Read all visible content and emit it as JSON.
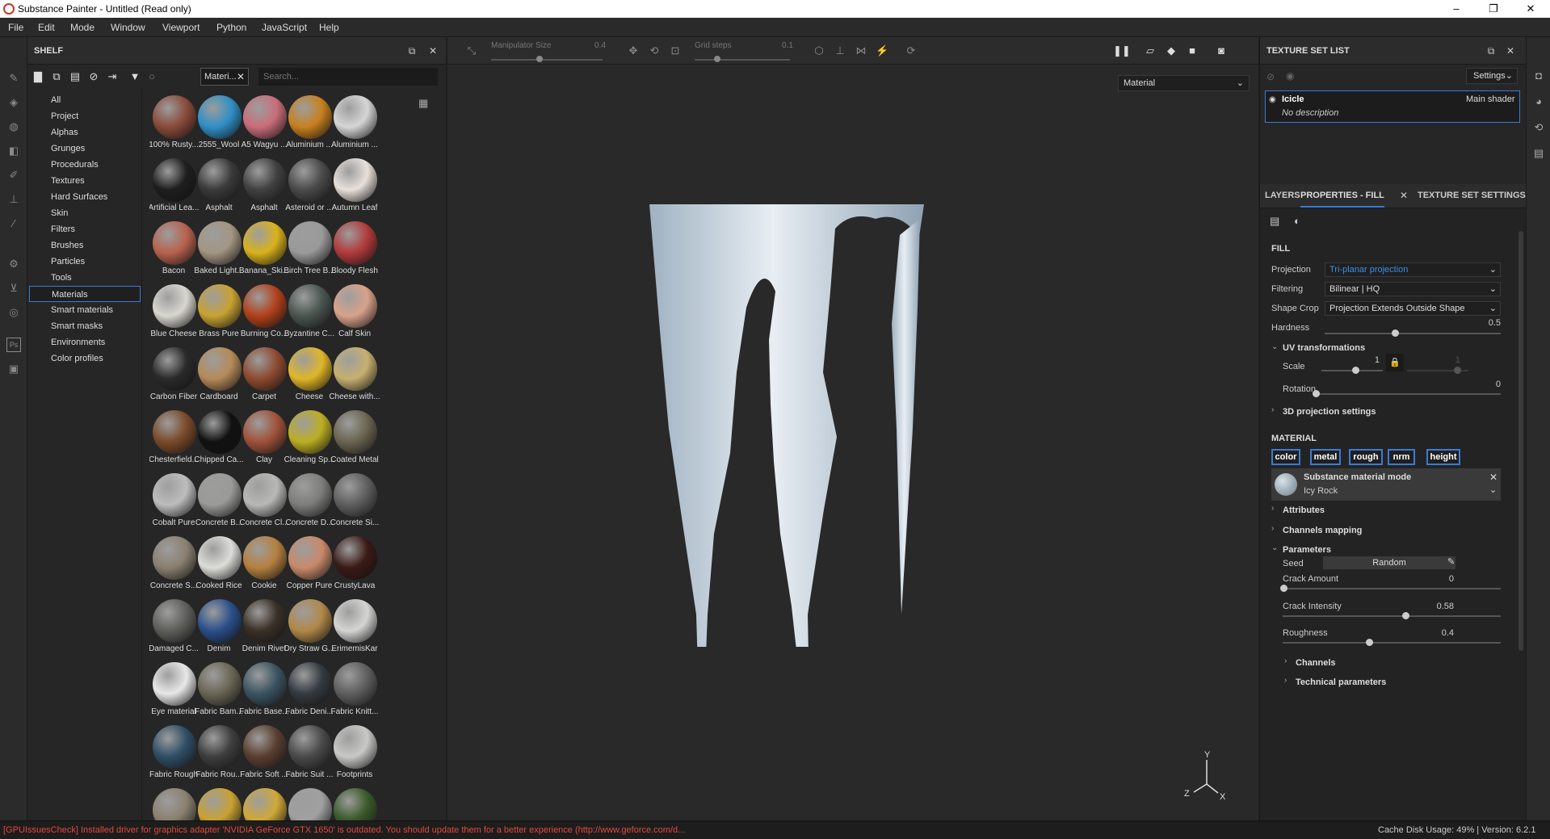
{
  "window": {
    "title": "Substance Painter - Untitled (Read only)",
    "minimize": "–",
    "maximize": "❐",
    "close": "✕"
  },
  "menu": [
    "File",
    "Edit",
    "Mode",
    "Window",
    "Viewport",
    "Python",
    "JavaScript",
    "Help"
  ],
  "shelf": {
    "title": "SHELF",
    "filter_chip": "Materi...",
    "search_placeholder": "Search...",
    "categories": [
      "All",
      "Project",
      "Alphas",
      "Grunges",
      "Procedurals",
      "Textures",
      "Hard Surfaces",
      "Skin",
      "Filters",
      "Brushes",
      "Particles",
      "Tools",
      "Materials",
      "Smart materials",
      "Smart masks",
      "Environments",
      "Color profiles"
    ],
    "selected_category": "Materials",
    "materials": [
      {
        "label": "100% Rusty...",
        "color": "#8a4a3a"
      },
      {
        "label": "2555_Wool",
        "color": "#2f8fc6"
      },
      {
        "label": "A5 Wagyu ...",
        "color": "#c96d7a"
      },
      {
        "label": "Aluminium ...",
        "color": "#c8801e"
      },
      {
        "label": "Aluminium ...",
        "color": "#d6d6d6"
      },
      {
        "label": "Artificial Lea...",
        "color": "#1e1e1e"
      },
      {
        "label": "Asphalt",
        "color": "#3a3a3a"
      },
      {
        "label": "Asphalt",
        "color": "#404040"
      },
      {
        "label": "Asteroid or ...",
        "color": "#4a4a4a"
      },
      {
        "label": "Autumn Leaf",
        "color": "#e8e0da"
      },
      {
        "label": "Bacon",
        "color": "#b8624e"
      },
      {
        "label": "Baked Light...",
        "color": "#a39582"
      },
      {
        "label": "Banana_Ski...",
        "color": "#d9b21c"
      },
      {
        "label": "Birch Tree B...",
        "color": "#9a9a9a"
      },
      {
        "label": "Bloody Flesh",
        "color": "#b23a3a"
      },
      {
        "label": "Blue Cheese",
        "color": "#d8d6cf"
      },
      {
        "label": "Brass Pure",
        "color": "#c9a232"
      },
      {
        "label": "Burning Co...",
        "color": "#b2401a"
      },
      {
        "label": "Byzantine C...",
        "color": "#4a5550"
      },
      {
        "label": "Calf Skin",
        "color": "#d8a28a"
      },
      {
        "label": "Carbon Fiber",
        "color": "#2a2a2a"
      },
      {
        "label": "Cardboard",
        "color": "#b58a58"
      },
      {
        "label": "Carpet",
        "color": "#8e4a30"
      },
      {
        "label": "Cheese",
        "color": "#e0b628"
      },
      {
        "label": "Cheese with...",
        "color": "#c6b070"
      },
      {
        "label": "Chesterfield...",
        "color": "#7a4a2a"
      },
      {
        "label": "Chipped Ca...",
        "color": "#111111"
      },
      {
        "label": "Clay",
        "color": "#a0523a"
      },
      {
        "label": "Cleaning Sp...",
        "color": "#bcae22"
      },
      {
        "label": "Coated Metal",
        "color": "#6a6450"
      },
      {
        "label": "Cobalt Pure",
        "color": "#bdbdbd"
      },
      {
        "label": "Concrete B...",
        "color": "#9a9a98"
      },
      {
        "label": "Concrete Cl...",
        "color": "#b8b8b6"
      },
      {
        "label": "Concrete D...",
        "color": "#7d7d7b"
      },
      {
        "label": "Concrete Si...",
        "color": "#5e5e5e"
      },
      {
        "label": "Concrete S...",
        "color": "#8a8070"
      },
      {
        "label": "Cooked Rice",
        "color": "#dcdcd8"
      },
      {
        "label": "Cookie",
        "color": "#b5803e"
      },
      {
        "label": "Copper Pure",
        "color": "#c9896a"
      },
      {
        "label": "CrustyLava",
        "color": "#3a1a16"
      },
      {
        "label": "Damaged C...",
        "color": "#5e5e5a"
      },
      {
        "label": "Denim",
        "color": "#2a4f8a"
      },
      {
        "label": "Denim Rivet",
        "color": "#3a3026"
      },
      {
        "label": "Dry Straw G...",
        "color": "#b08848"
      },
      {
        "label": "ErimemisKar",
        "color": "#d5d5d2"
      },
      {
        "label": "Eye material",
        "color": "#e8e8e8"
      },
      {
        "label": "Fabric Bam...",
        "color": "#6a6654"
      },
      {
        "label": "Fabric Base...",
        "color": "#3a5462"
      },
      {
        "label": "Fabric Deni...",
        "color": "#343a40"
      },
      {
        "label": "Fabric Knitt...",
        "color": "#5e5e5e"
      },
      {
        "label": "Fabric Rough",
        "color": "#2f4e66"
      },
      {
        "label": "Fabric Rou...",
        "color": "#3e3e3e"
      },
      {
        "label": "Fabric Soft ...",
        "color": "#5a3e30"
      },
      {
        "label": "Fabric Suit ...",
        "color": "#4a4a4a"
      },
      {
        "label": "Footprints",
        "color": "#c8c8c6"
      },
      {
        "label": "",
        "color": "#8a8070"
      },
      {
        "label": "",
        "color": "#c9a232"
      },
      {
        "label": "",
        "color": "#d0a838"
      },
      {
        "label": "",
        "color": "#a0a0a0"
      },
      {
        "label": "",
        "color": "#3a5a2a"
      }
    ]
  },
  "viewport": {
    "manipulator_label": "Manipulator Size",
    "manipulator_value": "0.4",
    "grid_label": "Grid steps",
    "grid_value": "0.1",
    "material_mode": "Material",
    "gizmo_axes": {
      "y": "Y",
      "z": "Z",
      "x": "X"
    }
  },
  "texture_set_list": {
    "title": "TEXTURE SET LIST",
    "settings": "Settings",
    "item_name": "Icicle",
    "item_shader": "Main shader",
    "item_desc": "No description"
  },
  "tabs": {
    "layers": "LAYERS",
    "properties": "PROPERTIES - FILL",
    "texture_set_settings": "TEXTURE SET SETTINGS"
  },
  "properties": {
    "fill_title": "FILL",
    "projection_label": "Projection",
    "projection_value": "Tri-planar projection",
    "filtering_label": "Filtering",
    "filtering_value": "Bilinear | HQ",
    "shape_crop_label": "Shape Crop",
    "shape_crop_value": "Projection Extends Outside Shape",
    "hardness_label": "Hardness",
    "hardness_value": "0.5",
    "uv_title": "UV transformations",
    "scale_label": "Scale",
    "scale_value": "1",
    "scale_value2": "1",
    "rotation_label": "Rotation",
    "rotation_value": "0",
    "proj3d_title": "3D projection settings",
    "material_title": "MATERIAL",
    "channels": [
      "color",
      "metal",
      "rough",
      "nrm",
      "height"
    ],
    "substance_mode": "Substance material mode",
    "substance_name": "Icy Rock",
    "attributes": "Attributes",
    "channels_mapping": "Channels mapping",
    "parameters": "Parameters",
    "seed_label": "Seed",
    "seed_value": "Random",
    "crack_amount_label": "Crack Amount",
    "crack_amount_value": "0",
    "crack_intensity_label": "Crack Intensity",
    "crack_intensity_value": "0.58",
    "roughness_label": "Roughness",
    "roughness_value": "0.4",
    "channels_sub": "Channels",
    "technical": "Technical parameters"
  },
  "status": {
    "message": "[GPUIssuesCheck] Installed driver for graphics adapter 'NVIDIA GeForce GTX 1650' is outdated. You should update them for a better experience (http://www.geforce.com/d...",
    "cache": "Cache Disk Usage:  49% | Version: 6.2.1"
  }
}
